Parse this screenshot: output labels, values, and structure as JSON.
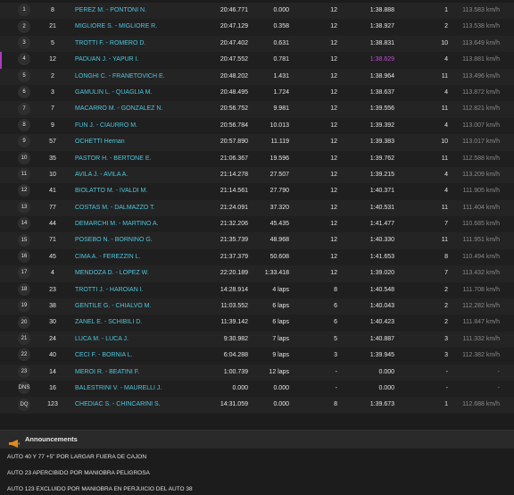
{
  "rows": [
    {
      "pos": "1",
      "num": "8",
      "driver": "PEREZ M. - PONTONI N.",
      "time": "20:46.771",
      "gap": "0.000",
      "laps": "12",
      "best": "1:38.888",
      "bestlap": "1",
      "speed": "113.583 km/h"
    },
    {
      "pos": "2",
      "num": "21",
      "driver": "MIGLIORE S. - MIGLIORE R.",
      "time": "20:47.129",
      "gap": "0.358",
      "laps": "12",
      "best": "1:38.927",
      "bestlap": "2",
      "speed": "113.538 km/h"
    },
    {
      "pos": "3",
      "num": "5",
      "driver": "TROTTI F. - ROMERO D.",
      "time": "20:47.402",
      "gap": "0.631",
      "laps": "12",
      "best": "1:38.831",
      "bestlap": "10",
      "speed": "113.649 km/h"
    },
    {
      "pos": "4",
      "num": "12",
      "driver": "PADUAN J. - YAPUR I.",
      "time": "20:47.552",
      "gap": "0.781",
      "laps": "12",
      "best": "1:38.629",
      "bestlap": "4",
      "speed": "113.881 km/h",
      "best_purple": true
    },
    {
      "pos": "5",
      "num": "2",
      "driver": "LONGHI C. - FRANETOVICH E.",
      "time": "20:48.202",
      "gap": "1.431",
      "laps": "12",
      "best": "1:38.964",
      "bestlap": "11",
      "speed": "113.496 km/h"
    },
    {
      "pos": "6",
      "num": "3",
      "driver": "GAMULIN L. - QUAGLIA M.",
      "time": "20:48.495",
      "gap": "1.724",
      "laps": "12",
      "best": "1:38.637",
      "bestlap": "4",
      "speed": "113.872 km/h"
    },
    {
      "pos": "7",
      "num": "7",
      "driver": "MACARRO M. - GONZALEZ N.",
      "time": "20:56.752",
      "gap": "9.981",
      "laps": "12",
      "best": "1:39.556",
      "bestlap": "11",
      "speed": "112.821 km/h"
    },
    {
      "pos": "8",
      "num": "9",
      "driver": "FUN J. - CIAURRO M.",
      "time": "20:56.784",
      "gap": "10.013",
      "laps": "12",
      "best": "1:39.392",
      "bestlap": "4",
      "speed": "113.007 km/h"
    },
    {
      "pos": "9",
      "num": "57",
      "driver": "OCHETTI Hernan",
      "time": "20:57.890",
      "gap": "11.119",
      "laps": "12",
      "best": "1:39.383",
      "bestlap": "10",
      "speed": "113.017 km/h"
    },
    {
      "pos": "10",
      "num": "35",
      "driver": "PASTOR H. - BERTONE E.",
      "time": "21:06.367",
      "gap": "19.596",
      "laps": "12",
      "best": "1:39.762",
      "bestlap": "11",
      "speed": "112.588 km/h"
    },
    {
      "pos": "11",
      "num": "10",
      "driver": "AVILA J. - AVILA A.",
      "time": "21:14.278",
      "gap": "27.507",
      "laps": "12",
      "best": "1:39.215",
      "bestlap": "4",
      "speed": "113.209 km/h"
    },
    {
      "pos": "12",
      "num": "41",
      "driver": "BIOLATTO M. - IVALDI M.",
      "time": "21:14.561",
      "gap": "27.790",
      "laps": "12",
      "best": "1:40.371",
      "bestlap": "4",
      "speed": "111.905 km/h"
    },
    {
      "pos": "13",
      "num": "77",
      "driver": "COSTAS M. - DALMAZZO T.",
      "time": "21:24.091",
      "gap": "37.320",
      "laps": "12",
      "best": "1:40.531",
      "bestlap": "11",
      "speed": "111.404 km/h"
    },
    {
      "pos": "14",
      "num": "44",
      "driver": "DEMARCHI M. - MARTINO A.",
      "time": "21:32.206",
      "gap": "45.435",
      "laps": "12",
      "best": "1:41.477",
      "bestlap": "7",
      "speed": "110.685 km/h"
    },
    {
      "pos": "15",
      "num": "71",
      "driver": "POSEBO N. - BORNINO G.",
      "time": "21:35.739",
      "gap": "48.968",
      "laps": "12",
      "best": "1:40.330",
      "bestlap": "11",
      "speed": "111.951 km/h"
    },
    {
      "pos": "16",
      "num": "45",
      "driver": "CIMA A. - FEREZZIN L.",
      "time": "21:37.379",
      "gap": "50.608",
      "laps": "12",
      "best": "1:41.653",
      "bestlap": "8",
      "speed": "110.494 km/h"
    },
    {
      "pos": "17",
      "num": "4",
      "driver": "MENDOZA D. - LOPEZ W.",
      "time": "22:20.189",
      "gap": "1:33.418",
      "laps": "12",
      "best": "1:39.020",
      "bestlap": "7",
      "speed": "113.432 km/h"
    },
    {
      "pos": "18",
      "num": "23",
      "driver": "TROTTI J. - HAROIAN I.",
      "time": "14:28.914",
      "gap": "4 laps",
      "laps": "8",
      "best": "1:40.548",
      "bestlap": "2",
      "speed": "111.708 km/h"
    },
    {
      "pos": "19",
      "num": "38",
      "driver": "GENTILE G. - CHIALVO M.",
      "time": "11:03.552",
      "gap": "6 laps",
      "laps": "6",
      "best": "1:40.043",
      "bestlap": "2",
      "speed": "112.282 km/h"
    },
    {
      "pos": "20",
      "num": "30",
      "driver": "ZANEL E. - SCHIBILI D.",
      "time": "11:39.142",
      "gap": "6 laps",
      "laps": "6",
      "best": "1:40.423",
      "bestlap": "2",
      "speed": "111.847 km/h"
    },
    {
      "pos": "21",
      "num": "24",
      "driver": "LUCA M. - LUCA J.",
      "time": "9:30.982",
      "gap": "7 laps",
      "laps": "5",
      "best": "1:40.887",
      "bestlap": "3",
      "speed": "111.332 km/h"
    },
    {
      "pos": "22",
      "num": "40",
      "driver": "CECI F. - BORNIA L.",
      "time": "6:04.288",
      "gap": "9 laps",
      "laps": "3",
      "best": "1:39.945",
      "bestlap": "3",
      "speed": "112.382 km/h"
    },
    {
      "pos": "23",
      "num": "14",
      "driver": "MEROI R. - BEATINI F.",
      "time": "1:00.739",
      "gap": "12 laps",
      "laps": "-",
      "best": "0.000",
      "bestlap": "-",
      "speed": "-"
    },
    {
      "pos": "DNS",
      "num": "16",
      "driver": "BALESTRINI V. - MAURELLI J.",
      "time": "0.000",
      "gap": "0.000",
      "laps": "-",
      "best": "0.000",
      "bestlap": "-",
      "speed": "-"
    },
    {
      "pos": "DQ",
      "num": "123",
      "driver": "CHEDIAC S. - CHINCARINI S.",
      "time": "14:31.059",
      "gap": "0.000",
      "laps": "8",
      "best": "1:39.673",
      "bestlap": "1",
      "speed": "112.688 km/h"
    }
  ],
  "announcements": {
    "title": "Announcements",
    "icon": "megaphone-icon",
    "items": [
      "AUTO 40 Y 77 +5\" POR LARGAR FUERA DE CAJON",
      "AUTO 23 APERCIBIDO POR MANIOBRA PELIGROSA",
      "AUTO 123 EXCLUIDO POR MANIOBRA EN PERJUICIO DEL AUTO 38"
    ]
  },
  "colors": {
    "driver": "#4fc6dd",
    "purple_best": "#c04fd6",
    "accent_icon": "#e08a1e"
  }
}
